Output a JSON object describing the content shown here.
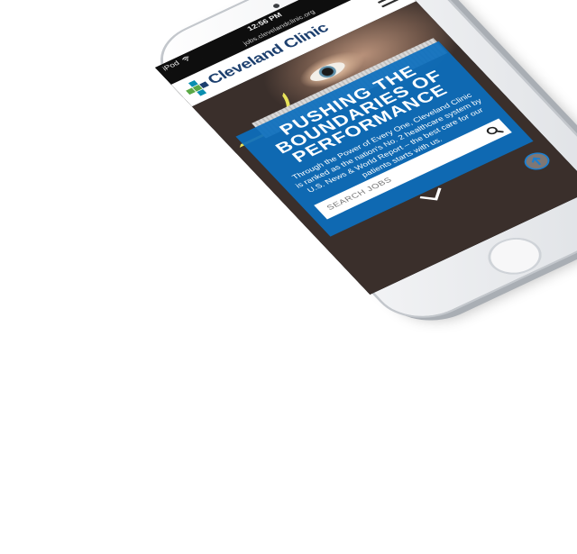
{
  "status_bar": {
    "carrier": "iPod",
    "wifi_icon": "wifi-icon",
    "time": "12:56 PM",
    "battery_level": 0.85,
    "battery_icon": "battery-icon"
  },
  "browser": {
    "url": "jobs.clevelandclinic.org"
  },
  "header": {
    "logo_text": "Cleveland Clinic",
    "logo_icon": "cleveland-clinic-cross-logo",
    "menu_icon": "hamburger-menu-icon"
  },
  "hero": {
    "title": "PUSHING THE BOUNDARIES OF PERFORMANCE",
    "text": "Through the Power of Every One, Cleveland Clinic is ranked as the nation's No. 2 healthcare system by U.S. News & World Report – the best care for our patients starts with us.",
    "search_placeholder": "SEARCH JOBS",
    "search_icon": "search-icon",
    "scroll_icon": "chevron-down-icon",
    "back_to_top_icon": "arrow-up-circle-icon"
  },
  "colors": {
    "brand_blue": "#0c6ebc",
    "logo_navy": "#1c3f6e",
    "logo_green": "#5aa845",
    "logo_teal": "#0a8fb0"
  }
}
